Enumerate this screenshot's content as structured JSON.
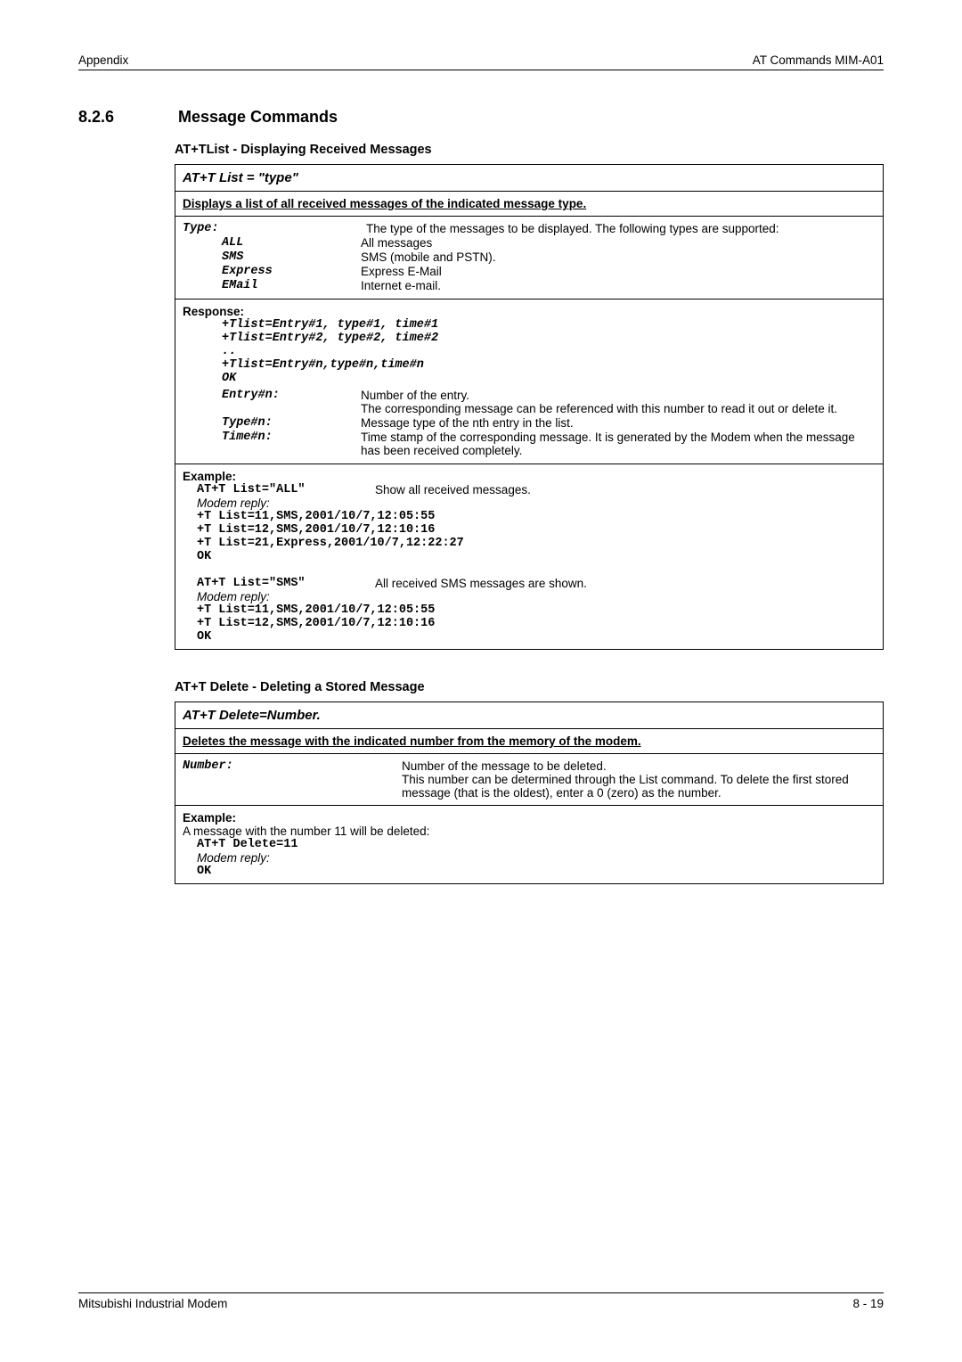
{
  "header": {
    "left": "Appendix",
    "right": "AT Commands MIM-A01"
  },
  "section": {
    "number": "8.2.6",
    "title": "Message Commands"
  },
  "tlist": {
    "title": "AT+TList  - Displaying Received Messages",
    "cmd": "AT+T List = \"type\"",
    "desc": "Displays a list of all received messages of the indicated message type.",
    "type_label": "Type:",
    "type_desc": "The type of the messages to be displayed. The following types are supported:",
    "types": [
      {
        "k": "ALL",
        "v": "All messages"
      },
      {
        "k": "SMS",
        "v": "SMS (mobile and PSTN)."
      },
      {
        "k": "Express",
        "v": "Express E-Mail"
      },
      {
        "k": "EMail",
        "v": "Internet e-mail."
      }
    ],
    "response_label": "Response:",
    "response_lines": [
      "+Tlist=Entry#1, type#1, time#1",
      "+Tlist=Entry#2, type#2, time#2",
      "..",
      "+Tlist=Entry#n,type#n,time#n",
      "OK"
    ],
    "resp_params": [
      {
        "k": "Entry#n:",
        "v": "Number of the entry.\nThe corresponding message can be referenced with this number to read it out or delete it."
      },
      {
        "k": "Type#n:",
        "v": "Message type of the nth entry in the list."
      },
      {
        "k": "Time#n:",
        "v": "Time stamp of the corresponding message. It is generated by the Modem when the message has been received completely."
      }
    ],
    "example_label": "Example:",
    "ex1_cmd": "AT+T List=\"ALL\"",
    "ex1_desc": "Show all received messages.",
    "modem_reply": "Modem reply:",
    "ex1_lines": [
      "+T List=11,SMS,2001/10/7,12:05:55",
      "+T List=12,SMS,2001/10/7,12:10:16",
      "+T List=21,Express,2001/10/7,12:22:27",
      "OK"
    ],
    "ex2_cmd": "AT+T List=\"SMS\"",
    "ex2_desc": "All received SMS messages are shown.",
    "ex2_lines": [
      "+T List=11,SMS,2001/10/7,12:05:55",
      "+T List=12,SMS,2001/10/7,12:10:16",
      "OK"
    ]
  },
  "tdel": {
    "title": "AT+T Delete - Deleting a Stored Message",
    "cmd": "AT+T Delete=Number.",
    "desc": "Deletes the message with the indicated number from the memory of the modem.",
    "num_label": "Number:",
    "num_desc": "Number of the message to be deleted.\nThis number can be determined through the List command. To delete the first stored message (that is the oldest), enter a 0 (zero) as the number.",
    "example_label": "Example:",
    "ex_intro": "A message with the number 11 will be deleted:",
    "ex_cmd": "AT+T Delete=11",
    "modem_reply": "Modem reply:",
    "ex_ok": "OK"
  },
  "footer": {
    "left": "Mitsubishi Industrial Modem",
    "right": "8 - 19"
  }
}
